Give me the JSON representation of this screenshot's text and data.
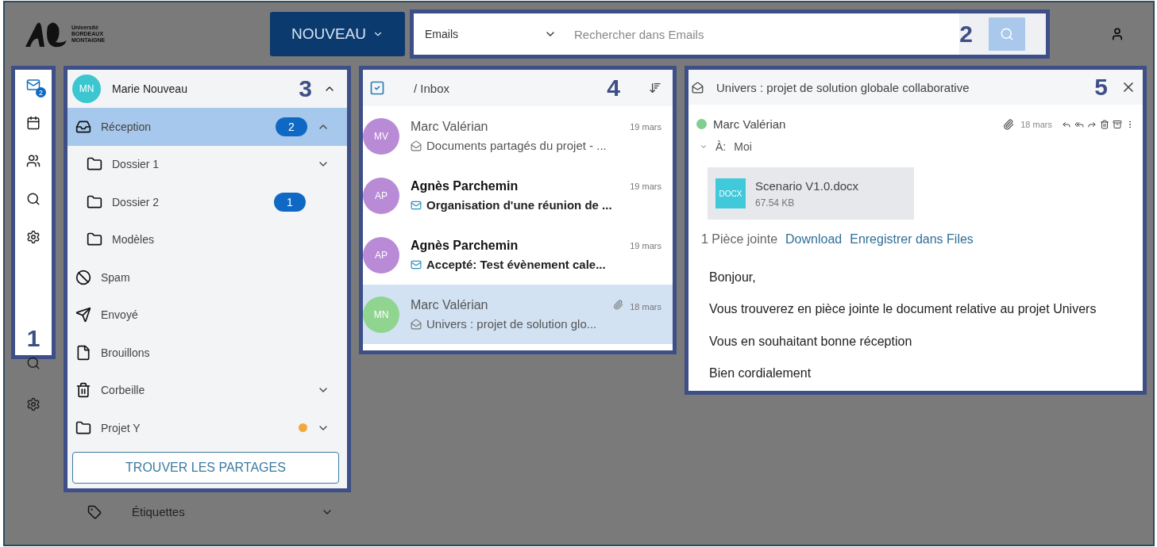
{
  "logo": {
    "lines": [
      "Université",
      "BORDEAUX",
      "MONTAIGNE"
    ]
  },
  "new_button": {
    "label": "NOUVEAU"
  },
  "search": {
    "scope": "Emails",
    "placeholder": "Rechercher dans Emails",
    "callout": "2"
  },
  "rail": {
    "callout": "1",
    "items": [
      {
        "kind": "mail",
        "badge": "2",
        "selected": true
      },
      {
        "kind": "calendar",
        "selected": false
      },
      {
        "kind": "contacts",
        "selected": false
      },
      {
        "kind": "search",
        "selected": false
      },
      {
        "kind": "settings",
        "selected": false
      }
    ]
  },
  "rail_overflow": [
    {
      "kind": "search"
    },
    {
      "kind": "settings"
    }
  ],
  "folders": {
    "callout": "3",
    "account": {
      "initials": "MN",
      "name": "Marie Nouveau",
      "expanded": true
    },
    "items": [
      {
        "kind": "inbox",
        "label": "Réception",
        "badge": "2",
        "selected": true,
        "expanded": true,
        "children": [
          {
            "kind": "folder",
            "label": "Dossier 1",
            "selected": false,
            "expanded": false
          },
          {
            "kind": "folder",
            "label": "Dossier 2",
            "badge": "1",
            "selected": false
          },
          {
            "kind": "folder",
            "label": "Modèles",
            "selected": false
          }
        ]
      },
      {
        "kind": "spam",
        "label": "Spam",
        "selected": false
      },
      {
        "kind": "sent",
        "label": "Envoyé",
        "selected": false
      },
      {
        "kind": "drafts",
        "label": "Brouillons",
        "selected": false
      },
      {
        "kind": "trash",
        "label": "Corbeille",
        "selected": false,
        "expanded": false
      },
      {
        "kind": "folder",
        "label": "Projet Y",
        "selected": false,
        "expanded": false,
        "color": "#f2a93b"
      }
    ],
    "share_button": "TROUVER LES PARTAGES"
  },
  "tags": {
    "label": "Étiquettes",
    "expanded": false
  },
  "message_list": {
    "title": "/ Inbox",
    "callout": "4",
    "messages": [
      {
        "initials": "MV",
        "color": "#b98ad6",
        "sender": "Marc Valérian",
        "date": "19 mars",
        "subject": "Documents partagés du projet - ...",
        "unread": false,
        "selected": false,
        "attachment": false
      },
      {
        "initials": "AP",
        "color": "#b98ad6",
        "sender": "Agnès Parchemin",
        "date": "19 mars",
        "subject": "Organisation d'une réunion de ...",
        "unread": true,
        "selected": false,
        "attachment": false
      },
      {
        "initials": "AP",
        "color": "#b98ad6",
        "sender": "Agnès Parchemin",
        "date": "19 mars",
        "subject": "Accepté: Test évènement cale...",
        "unread": true,
        "selected": false,
        "attachment": false
      },
      {
        "initials": "MN",
        "color": "#8fd48f",
        "sender": "Marc Valérian",
        "date": "18 mars",
        "subject": "Univers : projet de solution glo...",
        "unread": false,
        "selected": true,
        "attachment": true
      }
    ]
  },
  "reader": {
    "subject": "Univers : projet de solution globale collaborative",
    "callout": "5",
    "sender": "Marc Valérian",
    "date": "18 mars",
    "attachment": true,
    "to_label": "À:",
    "to": "Moi",
    "file": {
      "type": "DOCX",
      "name": "Scenario V1.0.docx",
      "size": "67.54 KB"
    },
    "attachment_count": "1 Pièce jointe",
    "links": [
      "Download",
      "Enregistrer dans Files"
    ],
    "body": [
      "Bonjour,",
      "Vous trouverez en pièce jointe le document relative au projet Univers",
      "Vous en souhaitant bonne réception",
      "Bien cordialement"
    ]
  }
}
